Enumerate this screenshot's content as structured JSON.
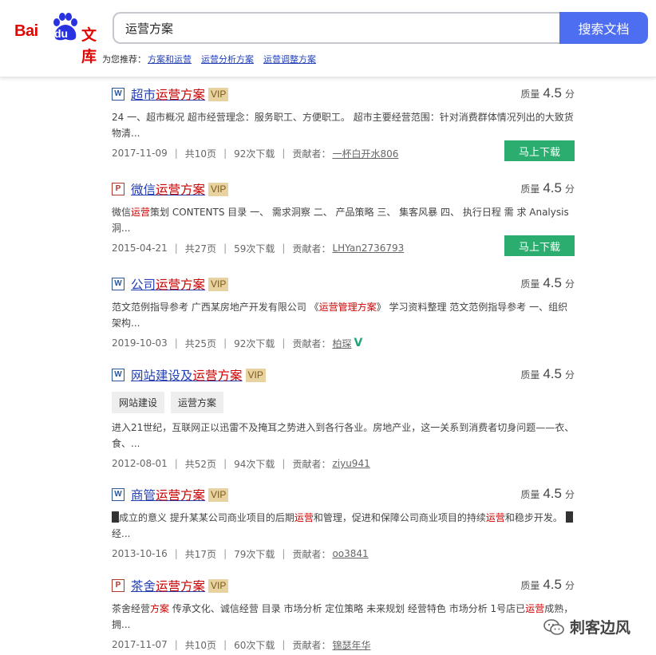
{
  "header": {
    "logo_text_bai": "Bai",
    "logo_text_du": "du",
    "logo_text_wenku": "文库",
    "search_value": "运营方案",
    "search_button": "搜索文档",
    "recommend_label": "为您推荐：",
    "recommend_links": [
      "方案和运营",
      "运营分析方案",
      "运营调整方案"
    ]
  },
  "labels": {
    "quality": "质量",
    "score_unit": "分",
    "vip": "VIP",
    "download": "马上下载",
    "contributor_prefix": "贡献者：",
    "sep": "|"
  },
  "results": [
    {
      "type": "W",
      "title_pre": "超市",
      "title_hl": "运营方案",
      "title_post": "",
      "score": "4.5",
      "desc_parts": [
        "24 一、超市概况 超市经营理念：服务职工、方便职工。 超市主要经营范围：针对消费群体情况列出的大致货物清..."
      ],
      "date": "2017-11-09",
      "pages": "共10页",
      "downloads": "92次下载",
      "contributor": "一杯白开水806",
      "has_download": true
    },
    {
      "type": "P",
      "title_pre": "微信",
      "title_hl": "运营方案",
      "title_post": "",
      "score": "4.5",
      "desc_a": "微信",
      "desc_hl": "运营",
      "desc_b": "策划 CONTENTS 目录 一、 需求洞察 二、 产品策略 三、 集客风暴 四、 执行日程 需 求 Analysis 洞...",
      "date": "2015-04-21",
      "pages": "共27页",
      "downloads": "59次下载",
      "contributor": "LHYan2736793",
      "has_download": true
    },
    {
      "type": "W",
      "title_pre": "公司",
      "title_hl": "运营方案",
      "title_post": "",
      "score": "4.5",
      "desc_a": "范文范例指导参考 广西某房地产开发有限公司 《",
      "desc_hl": "运营管理方案",
      "desc_b": "》 学习资料整理 范文范例指导参考 一、组织架构...",
      "date": "2019-10-03",
      "pages": "共25页",
      "downloads": "92次下载",
      "contributor": "柏琛",
      "verified_mark": "V"
    },
    {
      "type": "W",
      "title_pre": "网站建设及",
      "title_hl": "运营方案",
      "title_post": "",
      "score": "4.5",
      "tags": [
        "网站建设",
        "运营方案"
      ],
      "desc": "进入21世纪，互联网正以迅雷不及掩耳之势进入到各行各业。房地产业，这一关系到消费者切身问题——衣、食、...",
      "date": "2012-08-01",
      "pages": "共52页",
      "downloads": "94次下载",
      "contributor": "ziyu941"
    },
    {
      "type": "W",
      "title_pre": "商管",
      "title_hl": "运营方案",
      "title_post": "",
      "score": "4.5",
      "desc_a": "成立的意义 提升某某公司商业项目的后期",
      "desc_hl": "运营",
      "desc_b": "和管理，促进和保障公司商业项目的持续",
      "desc_hl2": "运营",
      "desc_c": "和稳步开发。",
      "desc_d": "经...",
      "date": "2013-10-16",
      "pages": "共17页",
      "downloads": "79次下载",
      "contributor": "oo3841"
    },
    {
      "type": "P",
      "title_pre": "茶舍",
      "title_hl": "运营方案",
      "title_post": "",
      "score": "4.5",
      "desc_a": "茶舍经营",
      "desc_hl": "方案",
      "desc_b": " 传承文化、诚信经营 目录 市场分析 定位策略 未来规划 经营特色 市场分析 1号店已",
      "desc_hl2": "运营",
      "desc_c": "成熟，拥...",
      "date": "2017-11-07",
      "pages": "共10页",
      "downloads": "60次下载",
      "contributor": "锦瑟年华"
    }
  ],
  "watermark": {
    "text": "刺客边风"
  },
  "colors": {
    "link": "#2440b3",
    "highlight": "#cc0000",
    "search_button": "#4e6ef2",
    "download": "#2cad70",
    "vip_bg": "#e8d29f"
  }
}
